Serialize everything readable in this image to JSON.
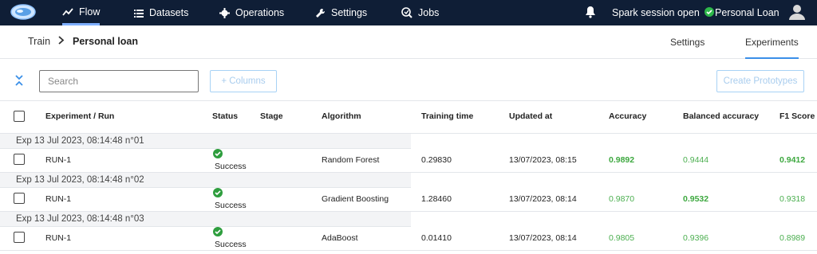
{
  "topnav": {
    "items": [
      {
        "label": "Flow",
        "icon": "flow-icon"
      },
      {
        "label": "Datasets",
        "icon": "list-icon"
      },
      {
        "label": "Operations",
        "icon": "gear-icon"
      },
      {
        "label": "Settings",
        "icon": "wrench-icon"
      },
      {
        "label": "Jobs",
        "icon": "jobs-icon"
      }
    ],
    "session_status": "Spark session open",
    "project": "Personal Loan"
  },
  "breadcrumb": {
    "parent": "Train",
    "current": "Personal loan"
  },
  "subtabs": [
    {
      "label": "Settings"
    },
    {
      "label": "Experiments"
    }
  ],
  "toolbar": {
    "search_placeholder": "Search",
    "columns_label": "+ Columns",
    "create_label": "Create Prototypes"
  },
  "table": {
    "headers": {
      "experiment": "Experiment / Run",
      "status": "Status",
      "stage": "Stage",
      "algorithm": "Algorithm",
      "training_time": "Training time",
      "updated_at": "Updated at",
      "accuracy": "Accuracy",
      "balanced_accuracy": "Balanced accuracy",
      "f1": "F1 Score"
    },
    "groups": [
      {
        "label": "Exp 13 Jul 2023, 08:14:48 n°01",
        "run": "RUN-1",
        "status": "Success",
        "algorithm": "Random Forest",
        "training_time": "0.29830",
        "updated_at": "13/07/2023, 08:15",
        "accuracy": "0.9892",
        "balanced_accuracy": "0.9444",
        "f1": "0.9412"
      },
      {
        "label": "Exp 13 Jul 2023, 08:14:48 n°02",
        "run": "RUN-1",
        "status": "Success",
        "algorithm": "Gradient Boosting",
        "training_time": "1.28460",
        "updated_at": "13/07/2023, 08:14",
        "accuracy": "0.9870",
        "balanced_accuracy": "0.9532",
        "f1": "0.9318"
      },
      {
        "label": "Exp 13 Jul 2023, 08:14:48 n°03",
        "run": "RUN-1",
        "status": "Success",
        "algorithm": "AdaBoost",
        "training_time": "0.01410",
        "updated_at": "13/07/2023, 08:14",
        "accuracy": "0.9805",
        "balanced_accuracy": "0.9396",
        "f1": "0.8989"
      }
    ]
  },
  "colors": {
    "nav_bg": "#0f1e36",
    "accent": "#3a8fe8",
    "success": "#2e9e3e",
    "metric": "#4caf50"
  }
}
